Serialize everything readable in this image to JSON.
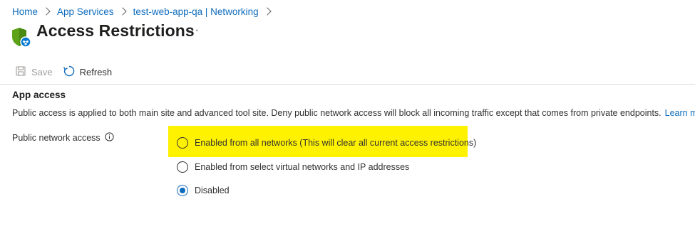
{
  "breadcrumb": [
    {
      "label": "Home"
    },
    {
      "label": "App Services"
    },
    {
      "label": "test-web-app-qa | Networking"
    }
  ],
  "page": {
    "title": "Access Restrictions",
    "more": "···",
    "icon": "shield-network-icon"
  },
  "toolbar": {
    "save_label": "Save",
    "save_enabled": false,
    "refresh_label": "Refresh"
  },
  "section": {
    "title": "App access",
    "description": "Public access is applied to both main site and advanced tool site. Deny public network access will block all incoming traffic except that comes from private endpoints.",
    "learn_more": "Learn more"
  },
  "field": {
    "label": "Public network access",
    "options": [
      {
        "label": "Enabled from all networks (This will clear all current access restrictions)",
        "selected": false,
        "highlighted": true
      },
      {
        "label": "Enabled from select virtual networks and IP addresses",
        "selected": false,
        "highlighted": false
      },
      {
        "label": "Disabled",
        "selected": true,
        "highlighted": false
      }
    ]
  },
  "colors": {
    "accent": "#0f6cbd",
    "highlight": "#fff200",
    "shield": "#5ea21a",
    "badge": "#0078d4"
  }
}
